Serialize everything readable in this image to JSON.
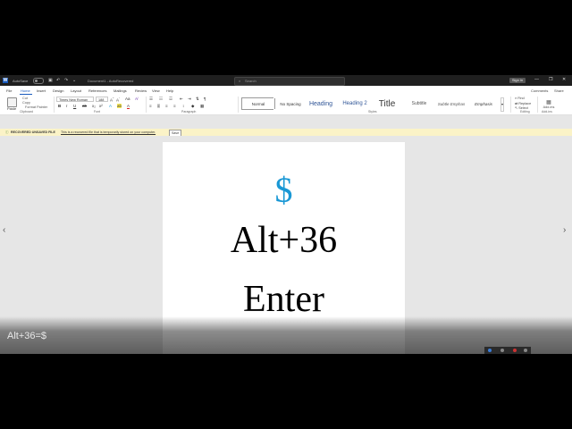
{
  "titlebar": {
    "logo": "W",
    "autosave": "AutoSave",
    "toggle": "Off",
    "doc_title": "Document1  -  AutoRecovered",
    "search_placeholder": "Search",
    "signin": "Sign in",
    "minimize": "—",
    "restore": "❐",
    "close": "✕"
  },
  "menu": {
    "tabs": [
      "File",
      "Home",
      "Insert",
      "Design",
      "Layout",
      "References",
      "Mailings",
      "Review",
      "View",
      "Help"
    ],
    "active_index": 1,
    "share": "Share",
    "comments": "Comments"
  },
  "ribbon": {
    "paste": "Paste",
    "cut": "Cut",
    "copy": "Copy",
    "format_painter": "Format Painter",
    "clipboard_label": "Clipboard",
    "font_name": "Times New Roman",
    "font_size": "188",
    "font_label": "Font",
    "paragraph_label": "Paragraph",
    "styles_label": "Styles",
    "editing_label": "Editing",
    "addins_label": "Add-ins",
    "styles": [
      "Normal",
      "No Spacing",
      "Heading",
      "Heading 2",
      "Title",
      "Subtitle",
      "Subtle Emphas",
      "Emphasis"
    ],
    "find": "Find",
    "replace": "Replace",
    "select": "Select",
    "addins": "Add-ins"
  },
  "infobar": {
    "title": "RECOVERED UNSAVED FILE",
    "message": "This is a recovered file that is temporarily stored on your computer.",
    "save_button": "Save"
  },
  "document": {
    "line1": "$",
    "line2": "Alt+36",
    "line3": "Enter"
  },
  "caption": "Alt+36=$",
  "colors": {
    "accent": "#185abd",
    "dollar": "#1a98d5",
    "infobar": "#fbf3c7"
  }
}
